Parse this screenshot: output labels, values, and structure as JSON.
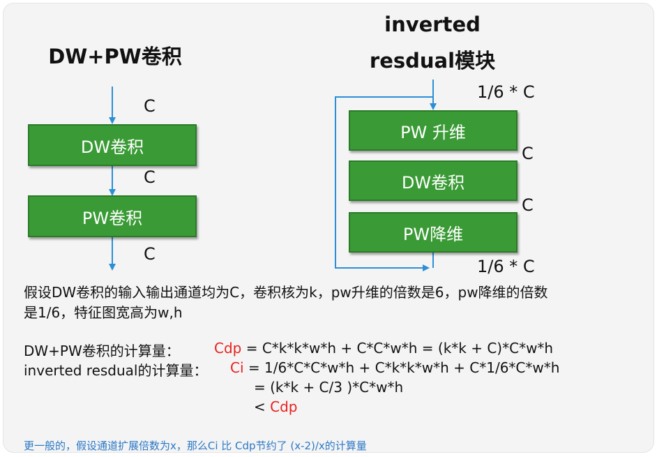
{
  "left_diagram": {
    "title": "DW+PW卷积",
    "box1": "DW卷积",
    "box2": "PW卷积",
    "label_top": "C",
    "label_mid": "C",
    "label_bottom": "C"
  },
  "right_diagram": {
    "title_line1": "inverted",
    "title_line2": "resdual模块",
    "box1": "PW 升维",
    "box2": "DW卷积",
    "box3": "PW降维",
    "label_top": "1/6 * C",
    "label_c1": "C",
    "label_c2": "C",
    "label_bottom": "1/6 * C"
  },
  "description": {
    "line1": "假设DW卷积的输入输出通道均为C，卷积核为k，pw升维的倍数是6，pw降维的倍数",
    "line2": "是1/6，特征图宽高为w,h"
  },
  "formulas": {
    "dwpw_label": "DW+PW卷积的计算量：",
    "dwpw_var": "Cdp",
    "dwpw_expr": " = C*k*k*w*h + C*C*w*h = (k*k + C)*C*w*h",
    "ir_label": "inverted resdual的计算量：",
    "ir_var": "Ci",
    "ir_expr": " = 1/6*C*C*w*h + C*k*k*w*h + C*1/6*C*w*h",
    "ir_expr2": "= (k*k + C/3 )*C*w*h",
    "ir_lt": "< ",
    "ir_lt_var": "Cdp"
  },
  "footnote": "更一般的，假设通道扩展倍数为x，那么Ci 比 Cdp节约了 (x-2)/x的计算量",
  "colors": {
    "box_green": "#3a9a35",
    "arrow_blue": "#2b8fd6",
    "highlight_red": "#e8201e",
    "note_blue": "#2b78c6"
  }
}
